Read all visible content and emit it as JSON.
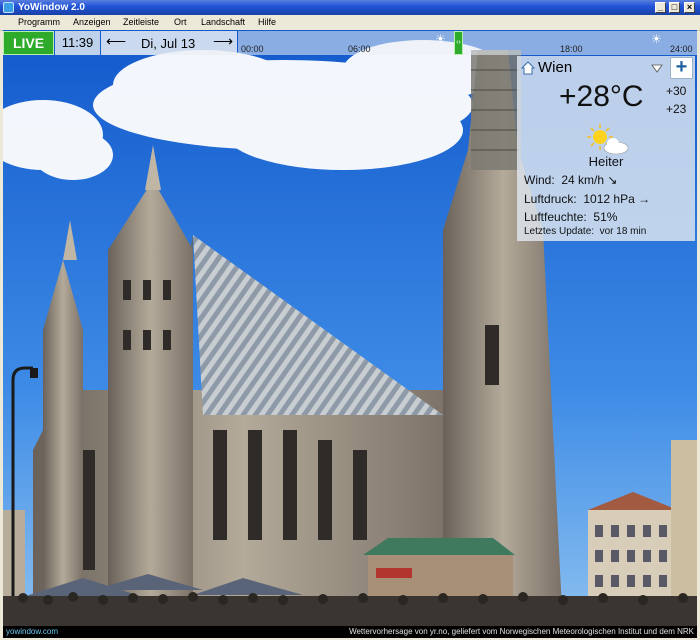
{
  "window": {
    "title": "YoWindow 2.0"
  },
  "menu": [
    "Programm",
    "Anzeigen",
    "Zeitleiste",
    "Ort",
    "Landschaft",
    "Hilfe"
  ],
  "topbar": {
    "live_label": "LIVE",
    "time": "11:39",
    "date": "Di, Jul 13",
    "prev_arrow": "⟵",
    "next_arrow": "⟶",
    "timeline_ticks": [
      "00:00",
      "06:00",
      "18:00",
      "24:00"
    ],
    "slider_glyph": "‹›"
  },
  "weather": {
    "city": "Wien",
    "temperature": "+28°C",
    "high": "+30",
    "low": "+23",
    "condition": "Heiter",
    "wind_label": "Wind:",
    "wind_value": "24 km/h ↘",
    "pressure_label": "Luftdruck:",
    "pressure_value": "1012 hPa →",
    "humidity_label": "Luftfeuchte:",
    "humidity_value": "51%",
    "update_label": "Letztes Update:",
    "update_value": "vor 18 min",
    "add_label": "+"
  },
  "status": {
    "site": "yowindow.com",
    "credit": "Wettervorhersage von yr.no, geliefert vom Norwegischen Meteorologischen Institut und dem NRK"
  },
  "colors": {
    "live_green": "#2eab2a",
    "sky": "#1f6fd6",
    "title_bar": "#2254d8"
  }
}
